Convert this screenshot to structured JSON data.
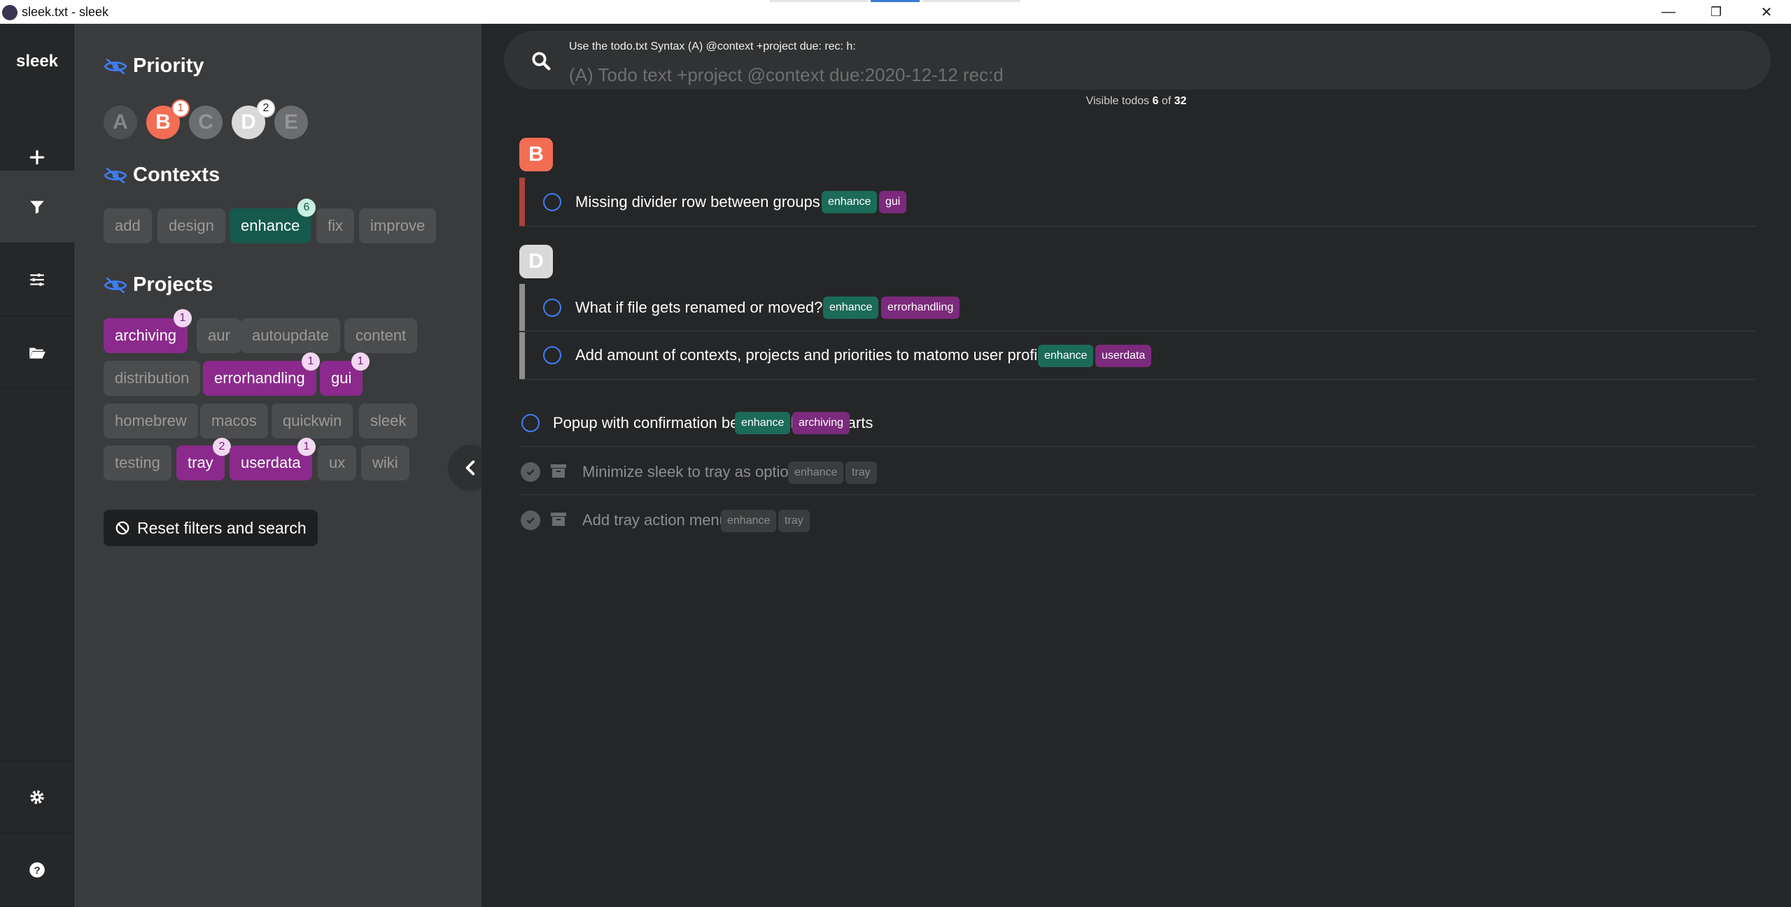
{
  "window": {
    "title": "sleek.txt - sleek",
    "minimize": "—",
    "restore": "❐",
    "close": "✕"
  },
  "nav": {
    "logo": "sleek",
    "items": [
      {
        "name": "add",
        "icon": "plus-icon"
      },
      {
        "name": "filter",
        "icon": "filter-icon",
        "active": true
      },
      {
        "name": "view",
        "icon": "sliders-icon"
      },
      {
        "name": "files",
        "icon": "folder-open-icon"
      },
      {
        "name": "settings",
        "icon": "gear-icon"
      },
      {
        "name": "help",
        "icon": "question-icon"
      }
    ]
  },
  "filters": {
    "priority": {
      "title": "Priority",
      "items": [
        {
          "label": "A",
          "badge": ""
        },
        {
          "label": "B",
          "badge": "1"
        },
        {
          "label": "C",
          "badge": ""
        },
        {
          "label": "D",
          "badge": "2"
        },
        {
          "label": "E",
          "badge": ""
        }
      ]
    },
    "contexts": {
      "title": "Contexts",
      "items": [
        {
          "label": "add"
        },
        {
          "label": "design"
        },
        {
          "label": "enhance",
          "badge": "6"
        },
        {
          "label": "fix"
        },
        {
          "label": "improve"
        }
      ]
    },
    "projects": {
      "title": "Projects",
      "items": [
        {
          "label": "archiving",
          "badge": "1"
        },
        {
          "label": "aur"
        },
        {
          "label": "autoupdate"
        },
        {
          "label": "content"
        },
        {
          "label": "distribution"
        },
        {
          "label": "errorhandling",
          "badge": "1"
        },
        {
          "label": "gui",
          "badge": "1"
        },
        {
          "label": "homebrew"
        },
        {
          "label": "macos"
        },
        {
          "label": "quickwin"
        },
        {
          "label": "sleek"
        },
        {
          "label": "testing"
        },
        {
          "label": "tray",
          "badge": "2"
        },
        {
          "label": "userdata",
          "badge": "1"
        },
        {
          "label": "ux"
        },
        {
          "label": "wiki"
        }
      ]
    },
    "reset_label": "Reset filters and search"
  },
  "search": {
    "hint": "Use the todo.txt Syntax (A) @context +project due: rec: h:",
    "placeholder": "(A) Todo text +project @context due:2020-12-12 rec:d"
  },
  "count": {
    "prefix": "Visible todos ",
    "visible": "6",
    "of": " of ",
    "total": "32"
  },
  "groups": [
    {
      "label": "B",
      "color": "#f36d55",
      "todos": [
        {
          "text": "Missing divider row between groups",
          "tags": [
            "enhance",
            "gui"
          ]
        }
      ]
    },
    {
      "label": "D",
      "color": "#d9d9d9",
      "todos": [
        {
          "text": "What if file gets renamed or moved?",
          "tags": [
            "enhance",
            "errorhandling"
          ]
        },
        {
          "text": "Add amount of contexts, projects and priorities to matomo user profile",
          "tags": [
            "enhance",
            "userdata"
          ]
        }
      ]
    }
  ],
  "ungrouped": [
    {
      "text": "Popup with confirmation before archiving starts",
      "tags": [
        "enhance",
        "archiving"
      ],
      "done": false
    },
    {
      "text": "Minimize sleek to tray as option",
      "tags": [
        "enhance",
        "tray"
      ],
      "done": true
    },
    {
      "text": "Add tray action menu",
      "tags": [
        "enhance",
        "tray"
      ],
      "done": true
    }
  ]
}
